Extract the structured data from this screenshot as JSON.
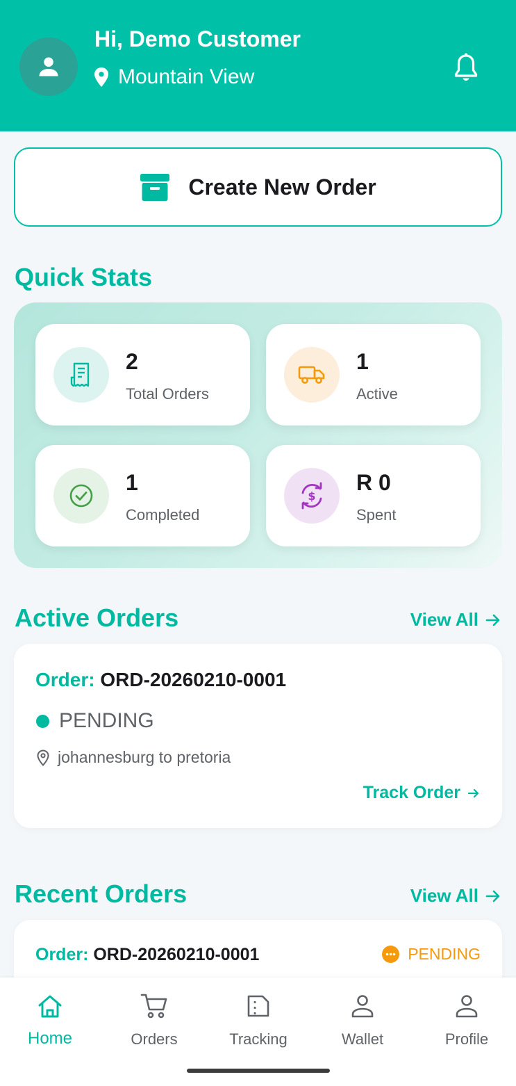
{
  "header": {
    "greeting": "Hi, Demo Customer",
    "location": "Mountain View",
    "icons": {
      "avatar": "person-icon",
      "location": "location-pin-icon",
      "notifications": "bell-icon"
    }
  },
  "create_order": {
    "label": "Create New Order",
    "icon": "archive-box-icon"
  },
  "quick_stats": {
    "title": "Quick Stats",
    "items": [
      {
        "value": "2",
        "label": "Total Orders",
        "icon": "receipt-icon",
        "color": "#00b9a1",
        "bg": "#dcf3ef"
      },
      {
        "value": "1",
        "label": "Active",
        "icon": "truck-icon",
        "color": "#f59a0c",
        "bg": "#fdeedb"
      },
      {
        "value": "1",
        "label": "Completed",
        "icon": "check-circle-icon",
        "color": "#43a047",
        "bg": "#e5f2e6"
      },
      {
        "value": "R 0",
        "label": "Spent",
        "icon": "currency-exchange-icon",
        "color": "#a434c2",
        "bg": "#f1e1f5"
      }
    ]
  },
  "active_orders": {
    "title": "Active Orders",
    "view_all": "View All",
    "order": {
      "prefix": "Order:",
      "number": "ORD-20260210-0001",
      "status": "PENDING",
      "route": "johannesburg to pretoria",
      "track_label": "Track Order"
    }
  },
  "recent_orders": {
    "title": "Recent Orders",
    "view_all": "View All",
    "order": {
      "prefix": "Order:",
      "number": "ORD-20260210-0001",
      "status": "PENDING"
    }
  },
  "bottom_nav": {
    "items": [
      {
        "label": "Home",
        "icon": "home-icon",
        "active": true
      },
      {
        "label": "Orders",
        "icon": "cart-icon",
        "active": false
      },
      {
        "label": "Tracking",
        "icon": "map-icon",
        "active": false
      },
      {
        "label": "Wallet",
        "icon": "person-outline-icon",
        "active": false
      },
      {
        "label": "Profile",
        "icon": "person-outline-icon",
        "active": false
      }
    ]
  },
  "colors": {
    "primary": "#00c0a8",
    "accent_text": "#00b9a1",
    "warning": "#f59a0c",
    "success": "#43a047",
    "purple": "#a434c2"
  }
}
